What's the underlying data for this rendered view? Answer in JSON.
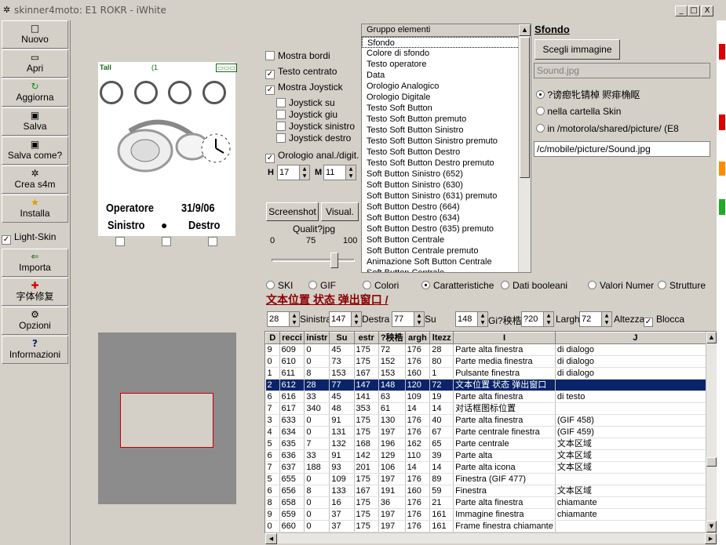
{
  "window": {
    "title": "skinner4moto: E1 ROKR - iWhite",
    "minimize": "_",
    "maximize": "□",
    "close": "X"
  },
  "toolbar": [
    {
      "label": "Nuovo",
      "icon": "□"
    },
    {
      "label": "Apri",
      "icon": "▭"
    },
    {
      "label": "Aggiorna",
      "icon": "↻"
    },
    {
      "label": "Salva",
      "icon": "▣"
    },
    {
      "label": "Salva come?",
      "icon": "▣"
    },
    {
      "label": "Crea s4m",
      "icon": "✲"
    },
    {
      "label": "Installa",
      "icon": "★"
    },
    {
      "label": "Importa",
      "icon": "⇐"
    },
    {
      "label": "字体修复",
      "icon": "✚"
    },
    {
      "label": "Opzioni",
      "icon": "⚙"
    },
    {
      "label": "Informazioni",
      "icon": "?"
    }
  ],
  "light_skin": {
    "label": "Light-Skin",
    "checked": true
  },
  "phone": {
    "status_left": "Tall",
    "status_mid": "(1",
    "status_right": "▭▭▭",
    "operator": "Operatore",
    "date": "31/9/06",
    "left_soft": "Sinistro",
    "right_soft": "Destro"
  },
  "options": {
    "mostra_bordi": "Mostra bordi",
    "testo_centrato": "Testo centrato",
    "mostra_joystick": "Mostra Joystick",
    "joystick_su": "Joystick su",
    "joystick_giu": "Joystick giu",
    "joystick_sinistro": "Joystick sinistro",
    "joystick_destro": "Joystick destro",
    "orologio": "Orologio anal./digit.",
    "h_label": "H",
    "h_value": "17",
    "m_label": "M",
    "m_value": "11",
    "screenshot": "Screenshot",
    "visual": "Visual.",
    "quality_label": "Qualit?jpg",
    "quality_ticks": [
      "0",
      "75",
      "100"
    ],
    "quality_value_percent": 75
  },
  "group_list": {
    "header": "Gruppo elementi",
    "items": [
      "Sfondo",
      "Colore di sfondo",
      "Testo operatore",
      "Data",
      "Orologio Analogico",
      "Orologio Digitale",
      "Testo Soft Button",
      "Testo Soft Button premuto",
      "Testo Soft Button Sinistro",
      "Testo Soft Button Sinistro premuto",
      "Testo Soft Button Destro",
      "Testo Soft Button Destro premuto",
      "Soft Button Sinistro (652)",
      "Soft Button Sinistro (630)",
      "Soft Button Sinistro (631) premuto",
      "Soft Button Destro (664)",
      "Soft Button Destro (634)",
      "Soft Button Destro (635) premuto",
      "Soft Button Centrale",
      "Soft Button Centrale premuto",
      "Animazione Soft Button Centrale",
      "Soft Button Centrale..."
    ]
  },
  "right_panel": {
    "title": "Sfondo",
    "choose_image": "Scegli immagine",
    "file_name": "Sound.jpg",
    "radio1": "?谤瘛牝锖棹 赆痱桷眍",
    "radio2": "nella cartella Skin",
    "radio3": "in /motorola/shared/picture/ (E8",
    "path": "/c/mobile/picture/Sound.jpg"
  },
  "tabs": [
    "SKI",
    "GIF",
    "Colori",
    "Caratteristiche",
    "Dati booleani",
    "Valori Numer",
    "Strutture"
  ],
  "tabs_selected": "Caratteristiche",
  "section_title": "文本位置 状态 弹出窗口 /",
  "fields": {
    "f1_value": "28",
    "sinistra_label": "Sinistra",
    "sinistra_value": "147",
    "destra_label": "Destra",
    "destra_value": "77",
    "su_label": "Su",
    "su_value": "148",
    "giu_label": "Gi?秧梏",
    "giu_value": "?20",
    "largh_label": "Largh.",
    "largh_value": "72",
    "altezza_label": "Altezza",
    "blocca_label": "Blocca"
  },
  "table": {
    "headers": [
      "D",
      "recci",
      "inistr",
      "Su",
      "estr",
      "?秧梏",
      "argh",
      "ltezz",
      "I",
      "J"
    ],
    "rows": [
      [
        "9",
        "609",
        "0",
        "45",
        "175",
        "72",
        "176",
        "28",
        "Parte alta finestra",
        "di dialogo"
      ],
      [
        "0",
        "610",
        "0",
        "73",
        "175",
        "152",
        "176",
        "80",
        "Parte media finestra",
        "di dialogo"
      ],
      [
        "1",
        "611",
        "8",
        "153",
        "167",
        "153",
        "160",
        "1",
        "Pulsante finestra",
        "di dialogo"
      ],
      [
        "2",
        "612",
        "28",
        "77",
        "147",
        "148",
        "120",
        "72",
        "文本位置 状态 弹出窗口",
        ""
      ],
      [
        "6",
        "616",
        "33",
        "45",
        "141",
        "63",
        "109",
        "19",
        "Parte alta finestra",
        "di testo"
      ],
      [
        "7",
        "617",
        "340",
        "48",
        "353",
        "61",
        "14",
        "14",
        "对话框图标位置",
        ""
      ],
      [
        "3",
        "633",
        "0",
        "91",
        "175",
        "130",
        "176",
        "40",
        "Parte alta finestra",
        "(GIF 458)"
      ],
      [
        "4",
        "634",
        "0",
        "131",
        "175",
        "197",
        "176",
        "67",
        "Parte centrale finestra",
        "(GIF 459)"
      ],
      [
        "5",
        "635",
        "7",
        "132",
        "168",
        "196",
        "162",
        "65",
        "Parte centrale",
        "文本区域"
      ],
      [
        "6",
        "636",
        "33",
        "91",
        "142",
        "129",
        "110",
        "39",
        "Parte alta",
        "文本区域"
      ],
      [
        "7",
        "637",
        "188",
        "93",
        "201",
        "106",
        "14",
        "14",
        "Parte alta icona",
        "文本区域"
      ],
      [
        "5",
        "655",
        "0",
        "109",
        "175",
        "197",
        "176",
        "89",
        "Finestra (GIF 477)",
        ""
      ],
      [
        "6",
        "656",
        "8",
        "133",
        "167",
        "191",
        "160",
        "59",
        "Finestra",
        "文本区域"
      ],
      [
        "8",
        "658",
        "0",
        "16",
        "175",
        "36",
        "176",
        "21",
        "Parte alta finestra",
        "chiamante"
      ],
      [
        "9",
        "659",
        "0",
        "37",
        "175",
        "197",
        "176",
        "161",
        "Immagine finestra",
        "chiamante"
      ],
      [
        "0",
        "660",
        "0",
        "37",
        "175",
        "197",
        "176",
        "161",
        "Frame finestra chiamante",
        ""
      ]
    ],
    "selected_row": 3
  },
  "colors": {
    "selection": "#0a246a",
    "section_title": "#8b0000",
    "preview_bg": "#8c8c8c",
    "preview_rect_border": "#c00000"
  }
}
